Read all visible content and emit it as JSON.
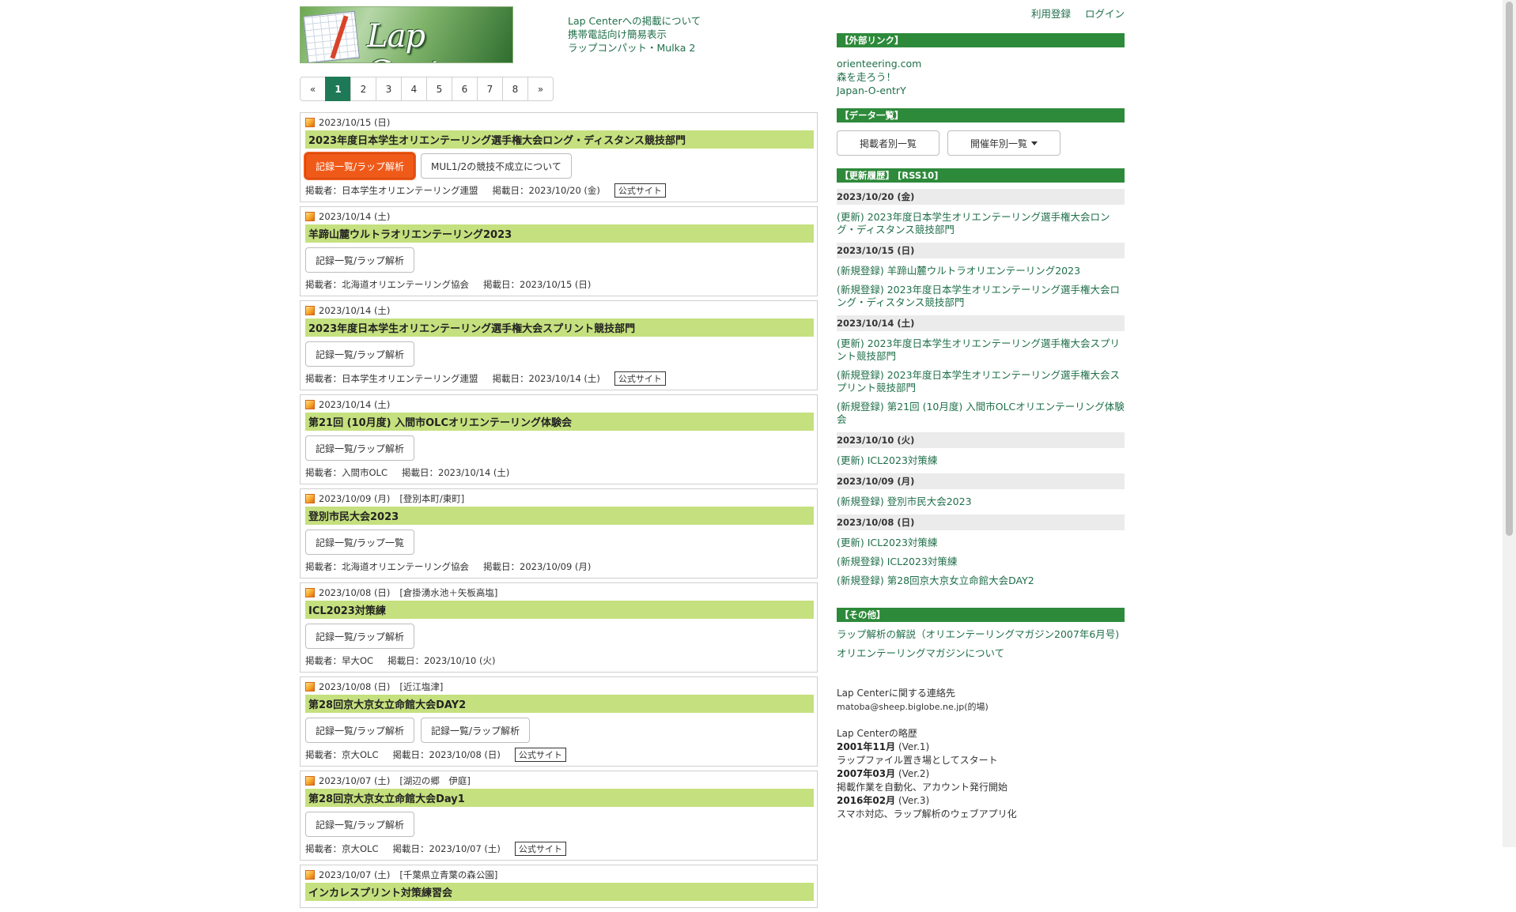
{
  "header": {
    "logo_text": "Lap Center",
    "links": [
      "Lap Centerへの掲載について",
      "携帯電話向け簡易表示",
      "ラップコンパット・Mulka 2"
    ],
    "register": "利用登録",
    "login": "ログイン"
  },
  "pager": [
    "«",
    "1",
    "2",
    "3",
    "4",
    "5",
    "6",
    "7",
    "8",
    "»"
  ],
  "entries": [
    {
      "date": "2023/10/15 (日)",
      "venue": "",
      "title": "2023年度日本学生オリエンテーリング選手権大会ロング・ディスタンス競技部門",
      "buttons": [
        "記録一覧/ラップ解析",
        "MUL1/2の競技不成立について"
      ],
      "publisher": "掲載者：日本学生オリエンテーリング連盟",
      "posted": "掲載日：2023/10/20 (金)",
      "official": "公式サイト"
    },
    {
      "date": "2023/10/14 (土)",
      "venue": "",
      "title": "羊蹄山麓ウルトラオリエンテーリング2023",
      "buttons": [
        "記録一覧/ラップ解析"
      ],
      "publisher": "掲載者：北海道オリエンテーリング協会",
      "posted": "掲載日：2023/10/15 (日)",
      "official": ""
    },
    {
      "date": "2023/10/14 (土)",
      "venue": "",
      "title": "2023年度日本学生オリエンテーリング選手権大会スプリント競技部門",
      "buttons": [
        "記録一覧/ラップ解析"
      ],
      "publisher": "掲載者：日本学生オリエンテーリング連盟",
      "posted": "掲載日：2023/10/14 (土)",
      "official": "公式サイト"
    },
    {
      "date": "2023/10/14 (土)",
      "venue": "",
      "title": "第21回 (10月度) 入間市OLCオリエンテーリング体験会",
      "buttons": [
        "記録一覧/ラップ解析"
      ],
      "publisher": "掲載者：入間市OLC",
      "posted": "掲載日：2023/10/14 (土)",
      "official": ""
    },
    {
      "date": "2023/10/09 (月)",
      "venue": "[登別本町/東町]",
      "title": "登別市民大会2023",
      "buttons": [
        "記録一覧/ラップ一覧"
      ],
      "publisher": "掲載者：北海道オリエンテーリング協会",
      "posted": "掲載日：2023/10/09 (月)",
      "official": ""
    },
    {
      "date": "2023/10/08 (日)",
      "venue": "[倉掛湧水池＋矢板高塩]",
      "title": "ICL2023対策練",
      "buttons": [
        "記録一覧/ラップ解析"
      ],
      "publisher": "掲載者：早大OC",
      "posted": "掲載日：2023/10/10 (火)",
      "official": ""
    },
    {
      "date": "2023/10/08 (日)",
      "venue": "[近江塩津]",
      "title": "第28回京大京女立命館大会DAY2",
      "buttons": [
        "記録一覧/ラップ解析",
        "記録一覧/ラップ解析"
      ],
      "publisher": "掲載者：京大OLC",
      "posted": "掲載日：2023/10/08 (日)",
      "official": "公式サイト"
    },
    {
      "date": "2023/10/07 (土)",
      "venue": "[湖辺の郷　伊庭]",
      "title": "第28回京大京女立命館大会Day1",
      "buttons": [
        "記録一覧/ラップ解析"
      ],
      "publisher": "掲載者：京大OLC",
      "posted": "掲載日：2023/10/07 (土)",
      "official": "公式サイト"
    },
    {
      "date": "2023/10/07 (土)",
      "venue": "[千葉県立青葉の森公園]",
      "title": "インカレスプリント対策練習会",
      "buttons": [],
      "publisher": "",
      "posted": "",
      "official": ""
    }
  ],
  "sidebar": {
    "external_head": "【外部リンク】",
    "external_links": [
      "orienteering.com",
      "森を走ろう！",
      "Japan-O-entrY"
    ],
    "data_head": "【データ一覧】",
    "data_btn1": "掲載者別一覧",
    "data_btn2": "開催年別一覧",
    "history_head": "【更新履歴】 [RSS10]",
    "history": [
      {
        "date": "2023/10/20 (金)",
        "items": [
          "(更新) 2023年度日本学生オリエンテーリング選手権大会ロング・ディスタンス競技部門"
        ]
      },
      {
        "date": "2023/10/15 (日)",
        "items": [
          "(新規登録) 羊蹄山麓ウルトラオリエンテーリング2023",
          "(新規登録) 2023年度日本学生オリエンテーリング選手権大会ロング・ディスタンス競技部門"
        ]
      },
      {
        "date": "2023/10/14 (土)",
        "items": [
          "(更新) 2023年度日本学生オリエンテーリング選手権大会スプリント競技部門",
          "(新規登録) 2023年度日本学生オリエンテーリング選手権大会スプリント競技部門",
          "(新規登録) 第21回 (10月度) 入間市OLCオリエンテーリング体験会"
        ]
      },
      {
        "date": "2023/10/10 (火)",
        "items": [
          "(更新) ICL2023対策練"
        ]
      },
      {
        "date": "2023/10/09 (月)",
        "items": [
          "(新規登録) 登別市民大会2023"
        ]
      },
      {
        "date": "2023/10/08 (日)",
        "items": [
          "(更新) ICL2023対策練",
          "(新規登録) ICL2023対策練",
          "(新規登録) 第28回京大京女立命館大会DAY2"
        ]
      }
    ],
    "other_head": "【その他】",
    "other_links": [
      "ラップ解析の解説（オリエンテーリングマガジン2007年6月号)",
      "オリエンテーリングマガジンについて"
    ],
    "contact_title": "Lap Centerに関する連絡先",
    "contact_email": "matoba@sheep.biglobe.ne.jp(的場)",
    "history_title": "Lap Centerの略歴",
    "timeline": [
      {
        "when": "2001年11月",
        "ver": "(Ver.1)",
        "desc": "ラップファイル置き場としてスタート"
      },
      {
        "when": "2007年03月",
        "ver": "(Ver.2)",
        "desc": "掲載作業を自動化、アカウント発行開始"
      },
      {
        "when": "2016年02月",
        "ver": "(Ver.3)",
        "desc": "スマホ対応、ラップ解析のウェブアプリ化"
      }
    ]
  },
  "colors": {
    "accent": "#2d8a3a",
    "title_bg": "#c5e07e",
    "highlight": "#f05a19",
    "pager_active": "#1e7a56"
  }
}
